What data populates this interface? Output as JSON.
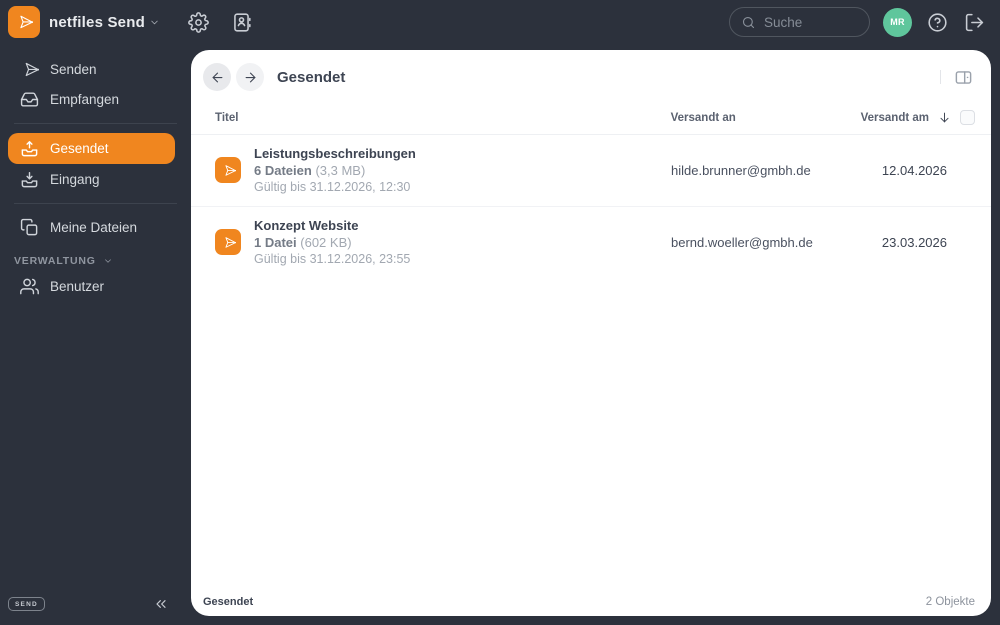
{
  "colors": {
    "accent": "#f0861f",
    "background": "#2c313c",
    "avatar": "#5fc69c",
    "panel": "#ffffff"
  },
  "header": {
    "app_title": "netfiles Send",
    "search_placeholder": "Suche",
    "avatar_initials": "MR"
  },
  "sidebar": {
    "items": [
      {
        "label": "Senden"
      },
      {
        "label": "Empfangen"
      },
      {
        "label": "Gesendet"
      },
      {
        "label": "Eingang"
      },
      {
        "label": "Meine Dateien"
      },
      {
        "label": "Benutzer"
      }
    ],
    "section_label": "VERWALTUNG",
    "collapse_tag": "SEND"
  },
  "main": {
    "title": "Gesendet",
    "table": {
      "col_title": "Titel",
      "col_recipient": "Versandt an",
      "col_date": "Versandt am",
      "rows": [
        {
          "title": "Leistungsbeschreibungen",
          "files": "6 Dateien",
          "size": "(3,3 MB)",
          "valid": "Gültig bis 31.12.2026, 12:30",
          "recipient": "hilde.brunner@gmbh.de",
          "date": "12.04.2026"
        },
        {
          "title": "Konzept Website",
          "files": "1 Datei",
          "size": "(602 KB)",
          "valid": "Gültig bis 31.12.2026, 23:55",
          "recipient": "bernd.woeller@gmbh.de",
          "date": "23.03.2026"
        }
      ]
    },
    "footer_label": "Gesendet",
    "footer_count": "2 Objekte"
  }
}
